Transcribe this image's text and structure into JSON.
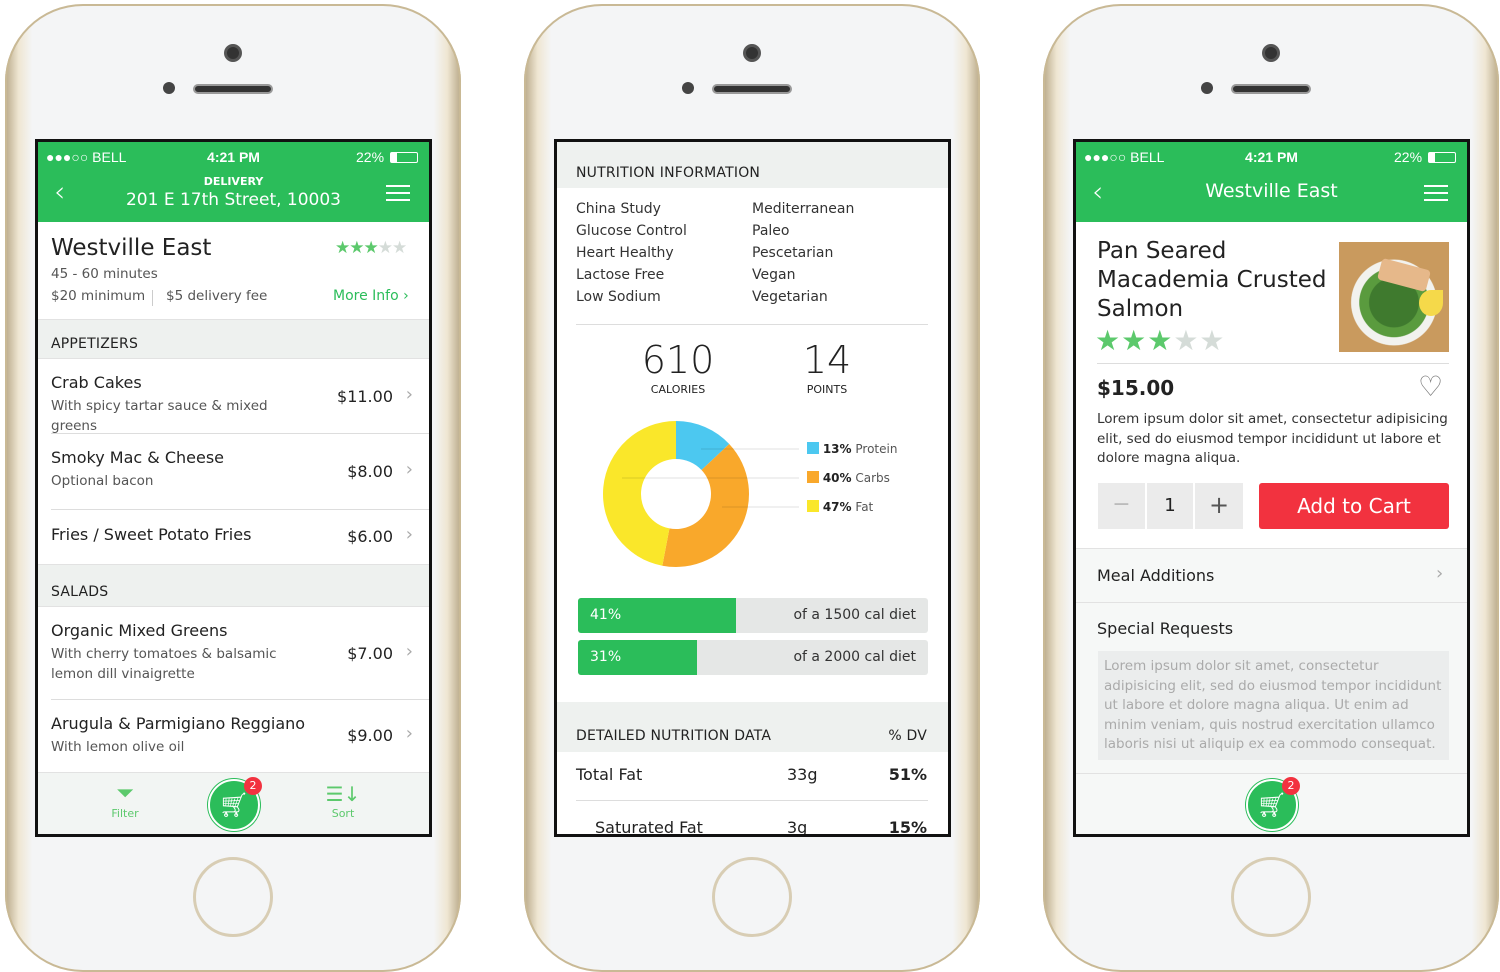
{
  "status": {
    "carrier": "●●●○○ BELL",
    "time": "4:21 PM",
    "battery": "22%"
  },
  "screen1": {
    "header_label": "DELIVERY",
    "header_address": "201 E 17th Street, 10003",
    "restaurant": {
      "name": "Westville East",
      "time": "45 - 60 minutes",
      "minimum": "$20 minimum",
      "fee": "$5 delivery fee",
      "more": "More Info",
      "rating": 3,
      "max_rating": 5
    },
    "sections": [
      {
        "title": "APPETIZERS",
        "items": [
          {
            "name": "Crab Cakes",
            "desc": "With spicy tartar sauce & mixed greens",
            "price": "$11.00"
          },
          {
            "name": "Smoky Mac & Cheese",
            "desc": "Optional bacon",
            "price": "$8.00"
          },
          {
            "name": "Fries / Sweet Potato Fries",
            "desc": "",
            "price": "$6.00"
          }
        ]
      },
      {
        "title": "SALADS",
        "items": [
          {
            "name": "Organic Mixed Greens",
            "desc": "With cherry tomatoes & balsamic lemon dill vinaigrette",
            "price": "$7.00"
          },
          {
            "name": "Arugula & Parmigiano Reggiano",
            "desc": "With lemon olive oil",
            "price": "$9.00"
          }
        ]
      }
    ],
    "filter": "Filter",
    "sort": "Sort",
    "cart_count": "2"
  },
  "screen2": {
    "title": "NUTRITION INFORMATION",
    "diets_left": [
      "China Study",
      "Glucose Control",
      "Heart Healthy",
      "Lactose Free",
      "Low Sodium"
    ],
    "diets_right": [
      "Mediterranean",
      "Paleo",
      "Pescetarian",
      "Vegan",
      "Vegetarian"
    ],
    "calories": "610",
    "calories_label": "CALORIES",
    "points": "14",
    "points_label": "POINTS",
    "chart_data": {
      "type": "pie",
      "donut": true,
      "slices": [
        {
          "label": "Protein",
          "pct": "13%",
          "value": 13,
          "color": "#4cc8f0"
        },
        {
          "label": "Carbs",
          "pct": "40%",
          "value": 40,
          "color": "#f9a82b"
        },
        {
          "label": "Fat",
          "pct": "47%",
          "value": 47,
          "color": "#fae72a"
        }
      ]
    },
    "bars": [
      {
        "pct": "41%",
        "value": 41,
        "label": "of a 1500 cal diet"
      },
      {
        "pct": "31%",
        "value": 31,
        "label": "of a 2000 cal diet"
      }
    ],
    "detail_title": "DETAILED NUTRITION DATA",
    "detail_dv": "% DV",
    "rows": [
      {
        "name": "Total Fat",
        "amount": "33g",
        "dv": "51%"
      },
      {
        "name": "Saturated Fat",
        "amount": "3g",
        "dv": "15%"
      }
    ]
  },
  "screen3": {
    "header_title": "Westville East",
    "dish_lines": [
      "Pan Seared",
      "Macademia Crusted",
      "Salmon"
    ],
    "rating": 3,
    "price": "$15.00",
    "desc": "Lorem ipsum dolor sit amet, consectetur adipisicing elit, sed do eiusmod tempor incididunt ut labore et dolore magna aliqua.",
    "qty": "1",
    "add": "Add to Cart",
    "meal_additions": "Meal Additions",
    "special": "Special Requests",
    "special_text": "Lorem ipsum dolor sit amet, consectetur adipisicing elit, sed do eiusmod tempor incididunt ut labore et dolore magna aliqua. Ut enim ad minim veniam, quis nostrud exercitation ullamco laboris nisi ut aliquip ex ea commodo consequat.",
    "cart_count": "2"
  },
  "colors": {
    "green": "#2bbd5a",
    "red": "#f2323f",
    "star_off": "#d5dcd8"
  }
}
